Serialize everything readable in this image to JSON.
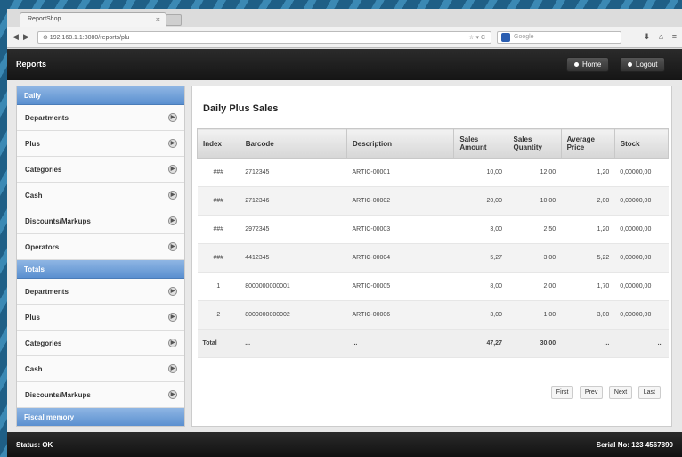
{
  "browser": {
    "tab_title": "ReportShop",
    "tab_close": "×",
    "url": "⊕ 192.168.1.1:8080/reports/plu",
    "url_controls": "☆ ▾ C",
    "search_placeholder": "Google",
    "nav_back": "◀",
    "nav_forward": "▶",
    "tools": [
      "⬇",
      "⌂",
      "≡"
    ]
  },
  "header": {
    "title": "Reports",
    "home_label": "Home",
    "logout_label": "Logout"
  },
  "sidebar": {
    "sections": [
      {
        "title": "Daily",
        "items": [
          "Departments",
          "Plus",
          "Categories",
          "Cash",
          "Discounts/Markups",
          "Operators"
        ]
      },
      {
        "title": "Totals",
        "items": [
          "Departments",
          "Plus",
          "Categories",
          "Cash",
          "Discounts/Markups"
        ]
      },
      {
        "title": "Fiscal memory",
        "items": []
      }
    ]
  },
  "main": {
    "title": "Daily Plus Sales",
    "columns": [
      "Index",
      "Barcode",
      "Description",
      "Sales Amount",
      "Sales Quantity",
      "Average Price",
      "Stock"
    ],
    "rows": [
      [
        "###",
        "2712345",
        "ARTIC-00001",
        "10,00",
        "12,00",
        "1,20",
        "0,00000,00"
      ],
      [
        "###",
        "2712346",
        "ARTIC-00002",
        "20,00",
        "10,00",
        "2,00",
        "0,00000,00"
      ],
      [
        "###",
        "2972345",
        "ARTIC-00003",
        "3,00",
        "2,50",
        "1,20",
        "0,00000,00"
      ],
      [
        "###",
        "4412345",
        "ARTIC-00004",
        "5,27",
        "3,00",
        "5,22",
        "0,00000,00"
      ],
      [
        "1",
        "8000000000001",
        "ARTIC-00005",
        "8,00",
        "2,00",
        "1,70",
        "0,00000,00"
      ],
      [
        "2",
        "8000000000002",
        "ARTIC-00006",
        "3,00",
        "1,00",
        "3,00",
        "0,00000,00"
      ]
    ],
    "total": [
      "Total",
      "...",
      "...",
      "47,27",
      "30,00",
      "...",
      "..."
    ],
    "pager": [
      "First",
      "Prev",
      "Next",
      "Last"
    ]
  },
  "footer": {
    "status": "Status: OK",
    "serial": "Serial No: 123 4567890"
  }
}
